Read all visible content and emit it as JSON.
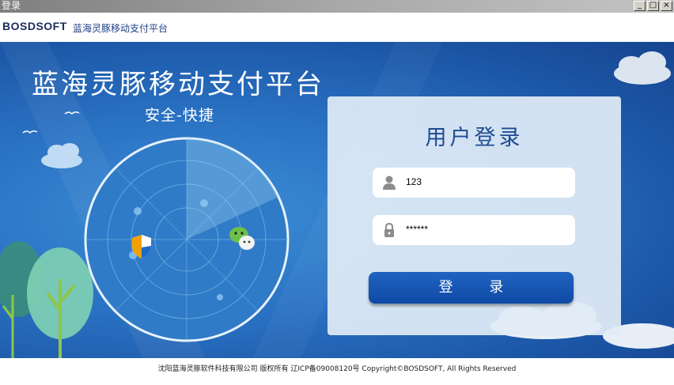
{
  "window": {
    "title": "登录",
    "controls": [
      "_",
      "□",
      "×"
    ]
  },
  "header": {
    "logo_text": "BOSDSOFT",
    "app_name": "蓝海灵豚移动支付平台"
  },
  "banner": {
    "title": "蓝海灵豚移动支付平台",
    "subtitle": "安全-快捷"
  },
  "login": {
    "title": "用户登录",
    "username_value": "123",
    "password_value": "******",
    "submit_label": "登 录"
  },
  "footer": {
    "copyright": "沈阳蓝海灵豚软件科技有限公司 版权所有 辽ICP备09008120号 Copyright©BOSDSOFT, All Rights Reserved"
  },
  "colors": {
    "banner_blue": "#2a72c3",
    "button_blue": "#0f4aa5",
    "title_blue": "#1e4a92"
  },
  "icons": [
    "shield-icon",
    "wechat-icon",
    "user-icon",
    "lock-icon"
  ]
}
